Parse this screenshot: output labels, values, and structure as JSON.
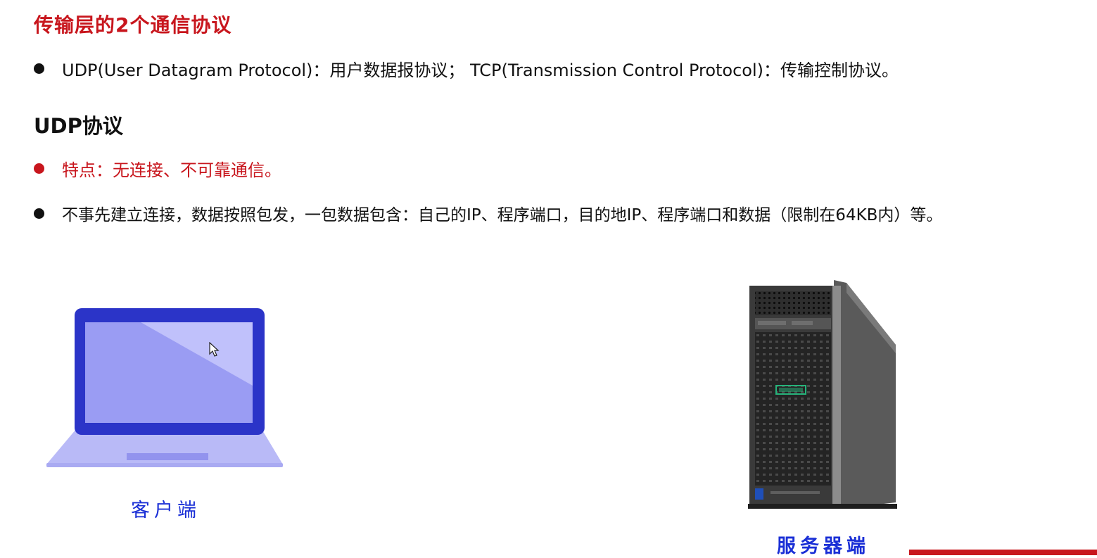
{
  "title": "传输层的2个通信协议",
  "bullets_top": [
    {
      "text": "UDP(User Datagram Protocol)：用户数据报协议； TCP(Transmission Control Protocol)：传输控制协议。"
    }
  ],
  "section_heading": "UDP协议",
  "bullets_udp": [
    {
      "text": "特点：无连接、不可靠通信。",
      "highlight": true
    },
    {
      "text": "不事先建立连接，数据按照包发，一包数据包含：自己的IP、程序端口，目的地IP、程序端口和数据（限制在64KB内）等。",
      "highlight": false
    }
  ],
  "diagram": {
    "client_label": "客户端",
    "server_label": "服务器端"
  },
  "colors": {
    "accent_red": "#c8161d",
    "caption_blue": "#1a2fd6",
    "laptop_frame": "#2b34c8",
    "laptop_screen": "#9a9cf3",
    "laptop_base": "#b9baf7"
  }
}
